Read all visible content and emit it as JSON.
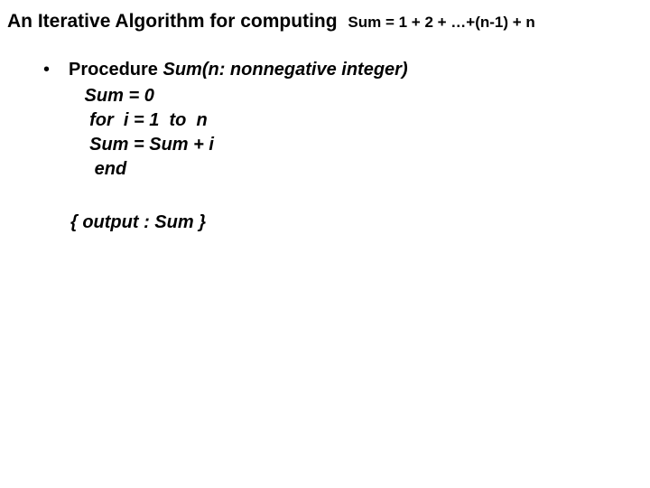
{
  "title": {
    "main": "An Iterative Algorithm for computing",
    "formula": "Sum = 1 + 2 + …+(n-1) + n"
  },
  "bullet_glyph": "•",
  "procedure": {
    "keyword": "Procedure ",
    "signature": "Sum(n: nonnegative integer)"
  },
  "code": {
    "l1": " Sum = 0",
    "l2": "  for  i = 1  to  n",
    "l3": "  Sum = Sum + i",
    "l4": "   end"
  },
  "output": "{ output : Sum }"
}
